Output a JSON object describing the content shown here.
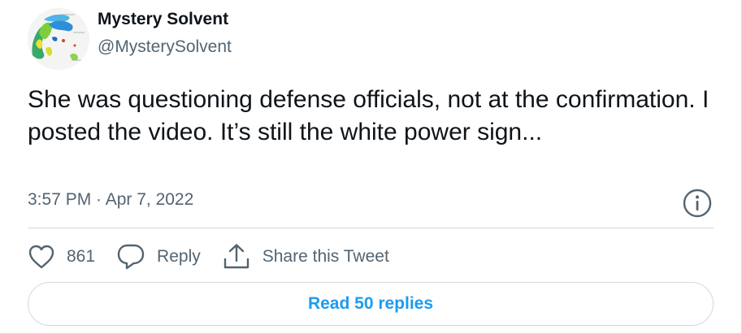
{
  "tweet": {
    "display_name": "Mystery Solvent",
    "handle": "@MysterySolvent",
    "text": "She was questioning defense officials, not at the confirmation. I posted the video. It’s still the white power sign...",
    "timestamp": "3:57 PM · Apr 7, 2022"
  },
  "actions": {
    "like_count": "861",
    "reply_label": "Reply",
    "share_label": "Share this Tweet"
  },
  "replies_button": {
    "label": "Read 50 replies"
  },
  "colors": {
    "accent": "#1d9bf0",
    "secondary_text": "#536471",
    "primary_text": "#0f1419",
    "border": "#cfd9de"
  },
  "icons": [
    "avatar-map-image",
    "info-icon",
    "heart-icon",
    "reply-bubble-icon",
    "share-icon"
  ]
}
